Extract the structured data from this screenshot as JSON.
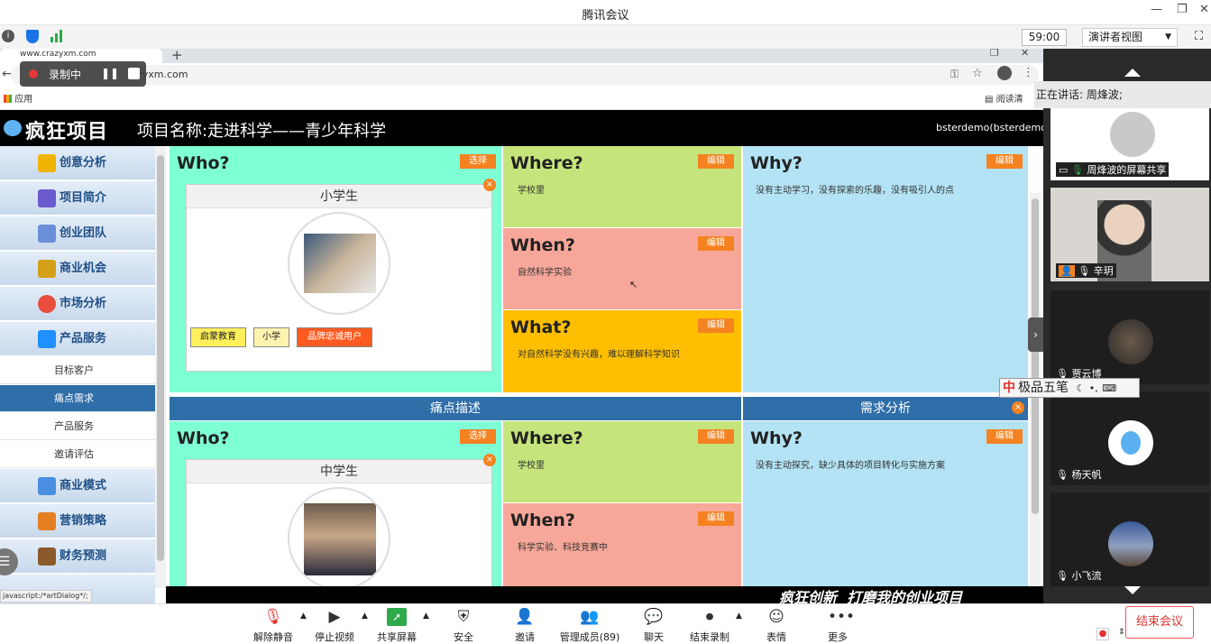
{
  "window": {
    "title": "腾讯会议"
  },
  "meeting": {
    "timer": "59:00",
    "presenter_view": "演讲者视图"
  },
  "browser": {
    "tab_url": "www.crazyxm.com",
    "url": "zyxm.com",
    "bookmark": "应用",
    "reader": "阅读清",
    "recording": "录制中",
    "status_url": "javascript:/*artDialog*/;"
  },
  "app": {
    "logo": "疯狂项目",
    "project": "项目名称:走进科学——青少年科学",
    "user": "bsterdemo(bsterdemo)"
  },
  "sidebar": {
    "items": [
      {
        "label": "创意分析",
        "color": "#f0b400"
      },
      {
        "label": "项目简介",
        "color": "#6a5acd"
      },
      {
        "label": "创业团队",
        "color": "#6a8fd8"
      },
      {
        "label": "商业机会",
        "color": "#d4a017"
      },
      {
        "label": "市场分析",
        "color": "#e74c3c"
      },
      {
        "label": "产品服务",
        "color": "#1e90ff"
      }
    ],
    "subitems": [
      "目标客户",
      "痛点需求",
      "产品服务",
      "邀请评估"
    ],
    "items2": [
      {
        "label": "商业模式",
        "color": "#4a90e2"
      },
      {
        "label": "营销策略",
        "color": "#e67e22"
      },
      {
        "label": "财务预测",
        "color": "#8b5a2b"
      }
    ]
  },
  "labels": {
    "who": "Who?",
    "where": "Where?",
    "when": "When?",
    "what": "What?",
    "why": "Why?",
    "choose": "选择",
    "edit": "编辑",
    "close": "×",
    "pain": "痛点描述",
    "demand": "需求分析"
  },
  "row1": {
    "card": "小学生",
    "tags": [
      "启蒙教育",
      "小学",
      "品牌忠诚用户"
    ],
    "where": "学校里",
    "when": "自然科学实验",
    "what": "对自然科学没有兴趣，难以理解科学知识",
    "why": "没有主动学习，没有探索的乐趣，没有吸引人的点"
  },
  "row2": {
    "card": "中学生",
    "where": "学校里",
    "when": "科学实验、科技竞赛中",
    "why": "没有主动探究，缺少具体的项目转化与实施方案"
  },
  "footer_slogan": "疯狂创新  打磨我的创业项目",
  "participants": {
    "speaking": "正在讲话: 周烽波;",
    "tiles": [
      {
        "name": "周烽波的屏幕共享"
      },
      {
        "name": "辛玥"
      },
      {
        "name": "贾云博"
      },
      {
        "name": "杨天帆"
      },
      {
        "name": "小飞流"
      }
    ]
  },
  "ime": "极品五笔",
  "toolbar": {
    "items": [
      {
        "icon": "mic-off-icon",
        "label": "解除静音"
      },
      {
        "icon": "video-icon",
        "label": "停止视频"
      },
      {
        "icon": "share-screen-icon",
        "label": "共享屏幕"
      },
      {
        "icon": "shield-icon",
        "label": "安全"
      },
      {
        "icon": "invite-icon",
        "label": "邀请"
      },
      {
        "icon": "members-icon",
        "label": "管理成员(89)"
      },
      {
        "icon": "chat-icon",
        "label": "聊天"
      },
      {
        "icon": "record-icon",
        "label": "结束录制"
      },
      {
        "icon": "emoji-icon",
        "label": "表情"
      },
      {
        "icon": "more-icon",
        "label": "更多"
      }
    ],
    "end": "结束会议"
  }
}
